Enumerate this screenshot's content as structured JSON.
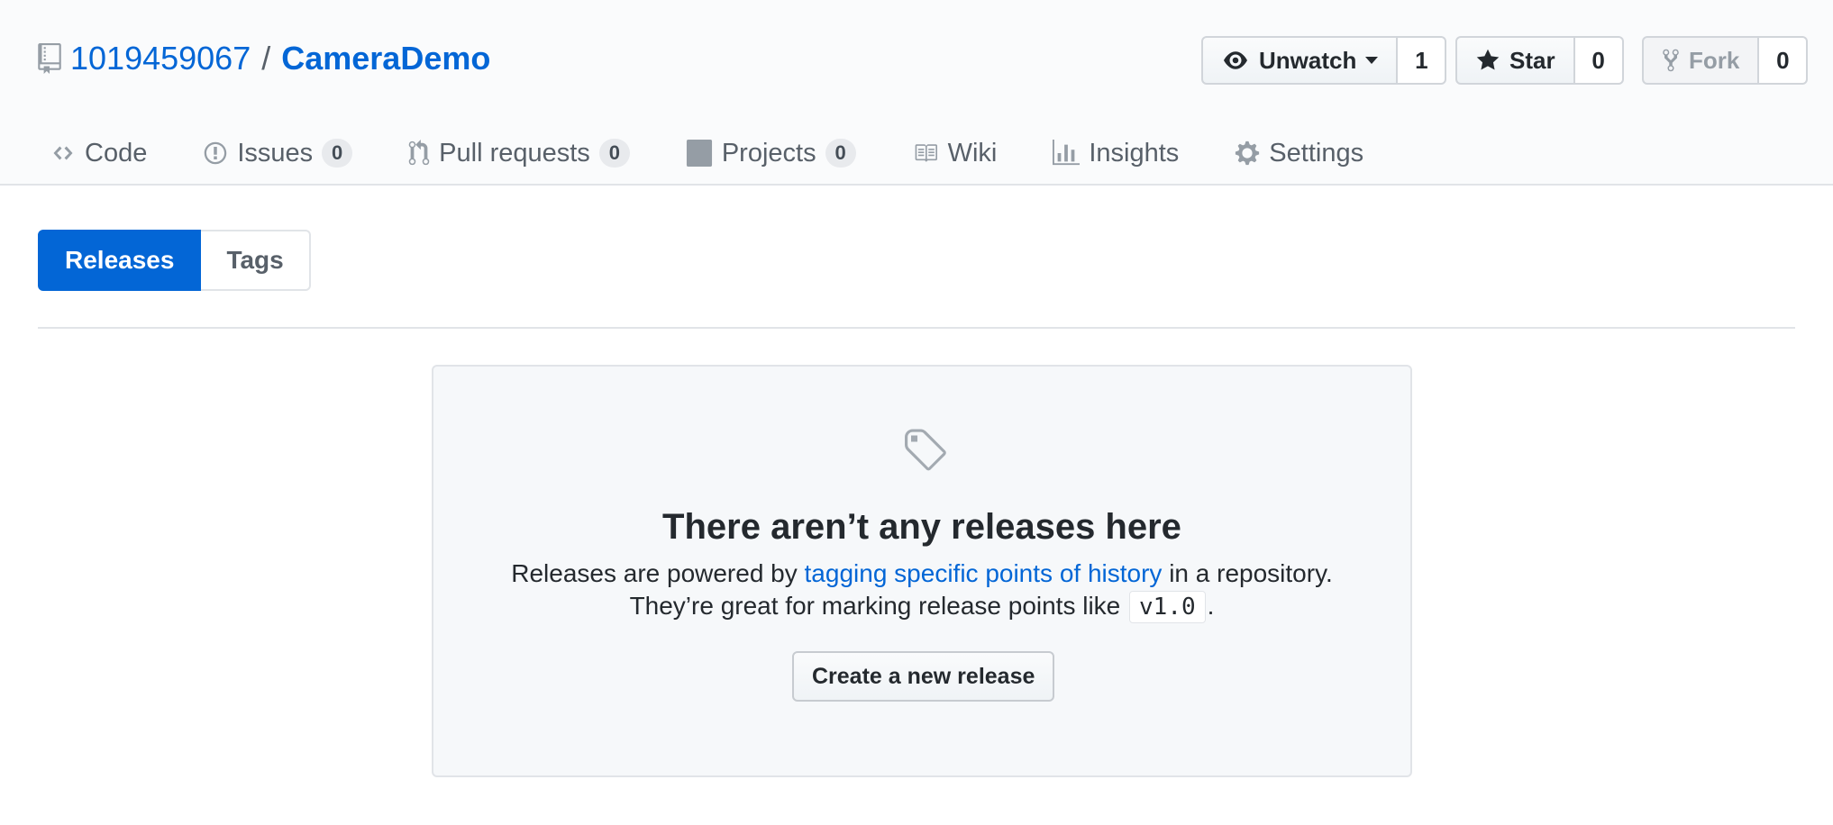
{
  "repo": {
    "owner": "1019459067",
    "separator": "/",
    "name": "CameraDemo"
  },
  "actions": {
    "watch": {
      "label": "Unwatch",
      "count": "1"
    },
    "star": {
      "label": "Star",
      "count": "0"
    },
    "fork": {
      "label": "Fork",
      "count": "0"
    }
  },
  "tabs": [
    {
      "label": "Code"
    },
    {
      "label": "Issues",
      "count": "0"
    },
    {
      "label": "Pull requests",
      "count": "0"
    },
    {
      "label": "Projects",
      "count": "0"
    },
    {
      "label": "Wiki"
    },
    {
      "label": "Insights"
    },
    {
      "label": "Settings"
    }
  ],
  "subnav": {
    "releases": "Releases",
    "tags": "Tags"
  },
  "blankslate": {
    "title": "There aren’t any releases here",
    "line1_before": "Releases are powered by ",
    "line1_link": "tagging specific points of history",
    "line1_after": " in a repository.",
    "line2_before": "They’re great for marking release points like ",
    "line2_code": "v1.0",
    "line2_after": ".",
    "button": "Create a new release"
  },
  "colors": {
    "link": "#0366d6",
    "selected": "#0366d6",
    "muted": "#586069"
  },
  "icons": [
    "repo-icon",
    "eye-icon",
    "star-icon",
    "fork-icon",
    "code-icon",
    "issue-icon",
    "pull-request-icon",
    "project-icon",
    "book-icon",
    "graph-icon",
    "gear-icon",
    "tag-icon"
  ]
}
